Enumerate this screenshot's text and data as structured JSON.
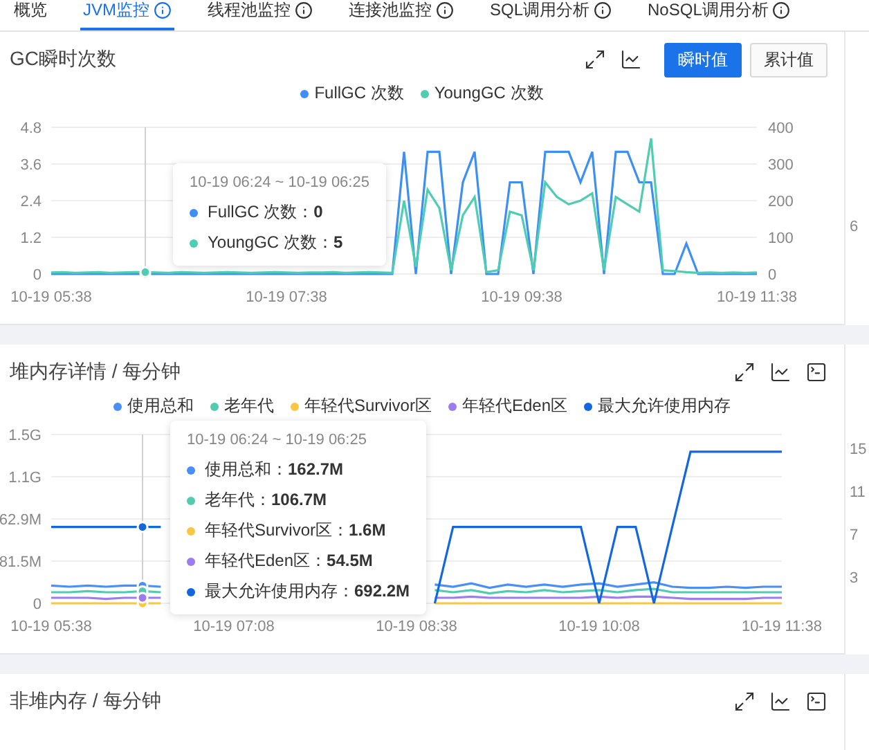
{
  "tabs": [
    {
      "label": "概览",
      "info": false,
      "selected": false
    },
    {
      "label": "JVM监控",
      "info": true,
      "selected": true
    },
    {
      "label": "线程池监控",
      "info": true,
      "selected": false
    },
    {
      "label": "连接池监控",
      "info": true,
      "selected": false
    },
    {
      "label": "SQL调用分析",
      "info": true,
      "selected": false
    },
    {
      "label": "NoSQL调用分析",
      "info": true,
      "selected": false
    }
  ],
  "panels": [
    {
      "title": "GC瞬时次数",
      "modes": [
        {
          "label": "瞬时值",
          "selected": true
        },
        {
          "label": "累计值",
          "selected": false
        }
      ],
      "side_labels": [
        "6"
      ],
      "tooltip": {
        "title": "10-19 06:24 ~ 10-19 06:25",
        "items": [
          "FullGC 次数：**0**",
          "YoungGC 次数：**5**"
        ]
      },
      "chart_data": {
        "type": "line",
        "categories": [
          "10-19 05:38",
          null,
          null,
          null,
          null,
          null,
          null,
          null,
          null,
          null,
          null,
          null,
          null,
          null,
          null,
          null,
          null,
          null,
          null,
          null,
          "10-19 07:38",
          null,
          null,
          null,
          null,
          null,
          null,
          null,
          null,
          null,
          null,
          null,
          null,
          null,
          null,
          null,
          null,
          null,
          null,
          null,
          "10-19 09:38",
          null,
          null,
          null,
          null,
          null,
          null,
          null,
          null,
          null,
          null,
          null,
          null,
          null,
          null,
          null,
          null,
          null,
          null,
          null,
          "10-19 11:38"
        ],
        "ylim": [
          0,
          4.8
        ],
        "y2lim": [
          0,
          400
        ],
        "grid": true,
        "yticks": [
          0,
          1.2,
          2.4,
          3.6,
          4.8
        ],
        "y2ticks": [
          0,
          100,
          200,
          300,
          400
        ],
        "series": [
          {
            "name": "FullGC 次数",
            "color": "#3d8ff5",
            "values": [
              0,
              0,
              0,
              0,
              0,
              0,
              0,
              0,
              0,
              0,
              0,
              0,
              0,
              0,
              0,
              0,
              0,
              0,
              0,
              0,
              0,
              0,
              0,
              0,
              0,
              0,
              0,
              0,
              0,
              0,
              4,
              0,
              4,
              4,
              0,
              3,
              4,
              0,
              0,
              3,
              3,
              0,
              4,
              4,
              4,
              3,
              4,
              0,
              4,
              4,
              3,
              3,
              0,
              0,
              1,
              0,
              0,
              0,
              0,
              0,
              0
            ]
          },
          {
            "name": "YoungGC 次数",
            "color": "#4ecdb3",
            "axis": "y2",
            "values": [
              4,
              5,
              3,
              4,
              5,
              3,
              4,
              5,
              5,
              4,
              3,
              5,
              4,
              3,
              4,
              5,
              4,
              3,
              4,
              5,
              4,
              3,
              4,
              4,
              5,
              3,
              4,
              5,
              4,
              3,
              200,
              20,
              230,
              180,
              10,
              160,
              210,
              5,
              10,
              170,
              160,
              10,
              250,
              210,
              190,
              200,
              220,
              10,
              210,
              190,
              170,
              370,
              10,
              8,
              5,
              3,
              4,
              3,
              4,
              3,
              4
            ]
          }
        ]
      }
    },
    {
      "title": "堆内存详情 / 每分钟",
      "side_labels": [
        "15",
        "11",
        "7",
        "3"
      ],
      "tooltip": {
        "title": "10-19 06:24 ~ 10-19 06:25",
        "items": [
          "使用总和：**162.7M**",
          "老年代：**106.7M**",
          "年轻代Survivor区：**1.6M**",
          "年轻代Eden区：**54.5M**",
          "最大允许使用内存：**692.2M**"
        ]
      },
      "chart_data": {
        "type": "line",
        "stacked": false,
        "categories": [
          "10-19 05:38",
          null,
          null,
          null,
          null,
          null,
          null,
          null,
          null,
          null,
          "10-19 07:08",
          null,
          null,
          null,
          null,
          null,
          null,
          null,
          null,
          null,
          "10-19 08:38",
          null,
          null,
          null,
          null,
          null,
          null,
          null,
          null,
          null,
          "10-19 10:08",
          null,
          null,
          null,
          null,
          null,
          null,
          null,
          null,
          null,
          "10-19 11:38"
        ],
        "ylim": [
          0,
          1.526
        ],
        "grid": true,
        "yticks": [
          {
            "value": 0,
            "label": "0"
          },
          {
            "label": "81.5M"
          },
          {
            "label": "62.9M"
          },
          {
            "value": 1.1444,
            "label": "1.1G"
          },
          {
            "value": 1.5259,
            "label": "1.5G"
          }
        ],
        "series": [
          {
            "name": "使用总和",
            "color": "#4a8ff7",
            "values": [
              0.16,
              0.15,
              0.16,
              0.15,
              0.16,
              0.16,
              0.15,
              null,
              null,
              null,
              null,
              null,
              null,
              null,
              null,
              null,
              null,
              null,
              null,
              null,
              null,
              0.17,
              0.15,
              0.18,
              0.14,
              0.17,
              0.15,
              0.17,
              0.15,
              0.17,
              0.18,
              0.15,
              0.17,
              0.19,
              0.15,
              0.14,
              0.14,
              0.15,
              0.14,
              0.15,
              0.15
            ]
          },
          {
            "name": "老年代",
            "color": "#52cbb1",
            "values": [
              0.1,
              0.1,
              0.11,
              0.1,
              0.1,
              0.11,
              0.1,
              null,
              null,
              null,
              null,
              null,
              null,
              null,
              null,
              null,
              null,
              null,
              null,
              null,
              null,
              0.12,
              0.1,
              0.12,
              0.09,
              0.11,
              0.1,
              0.12,
              0.1,
              0.11,
              0.12,
              0.1,
              0.12,
              0.13,
              0.1,
              0.1,
              0.1,
              0.1,
              0.1,
              0.1,
              0.1
            ]
          },
          {
            "name": "年轻代Survivor区",
            "color": "#f9c742",
            "values": [
              0,
              0,
              0,
              0,
              0,
              0,
              0,
              null,
              null,
              null,
              null,
              null,
              null,
              null,
              null,
              null,
              null,
              null,
              null,
              null,
              null,
              0,
              0,
              0,
              0,
              0,
              0,
              0,
              0,
              0,
              0,
              0,
              0,
              0,
              0,
              0,
              0,
              0,
              0,
              0,
              0
            ]
          },
          {
            "name": "年轻代Eden区",
            "color": "#9d7cf0",
            "values": [
              0.05,
              0.05,
              0.05,
              0.04,
              0.05,
              0.05,
              0.05,
              null,
              null,
              null,
              null,
              null,
              null,
              null,
              null,
              null,
              null,
              null,
              null,
              null,
              null,
              0.05,
              0.05,
              0.06,
              0.05,
              0.05,
              0.05,
              0.05,
              0.05,
              0.05,
              0.06,
              0.05,
              0.06,
              0.06,
              0.05,
              0.04,
              0.04,
              0.04,
              0.04,
              0.05,
              0.05
            ]
          },
          {
            "name": "最大允许使用内存",
            "color": "#1266e0",
            "values": [
              0.69,
              0.69,
              0.69,
              0.69,
              0.69,
              0.69,
              0.69,
              null,
              null,
              null,
              null,
              null,
              null,
              null,
              null,
              null,
              null,
              null,
              null,
              null,
              null,
              0,
              0.69,
              0.69,
              0.69,
              0.69,
              0.69,
              0.69,
              0.69,
              0.69,
              0,
              0.69,
              0.69,
              0,
              0.69,
              1.37,
              1.37,
              1.37,
              1.37,
              1.37,
              1.37
            ]
          }
        ]
      }
    },
    {
      "title": "非堆内存 / 每分钟"
    }
  ]
}
